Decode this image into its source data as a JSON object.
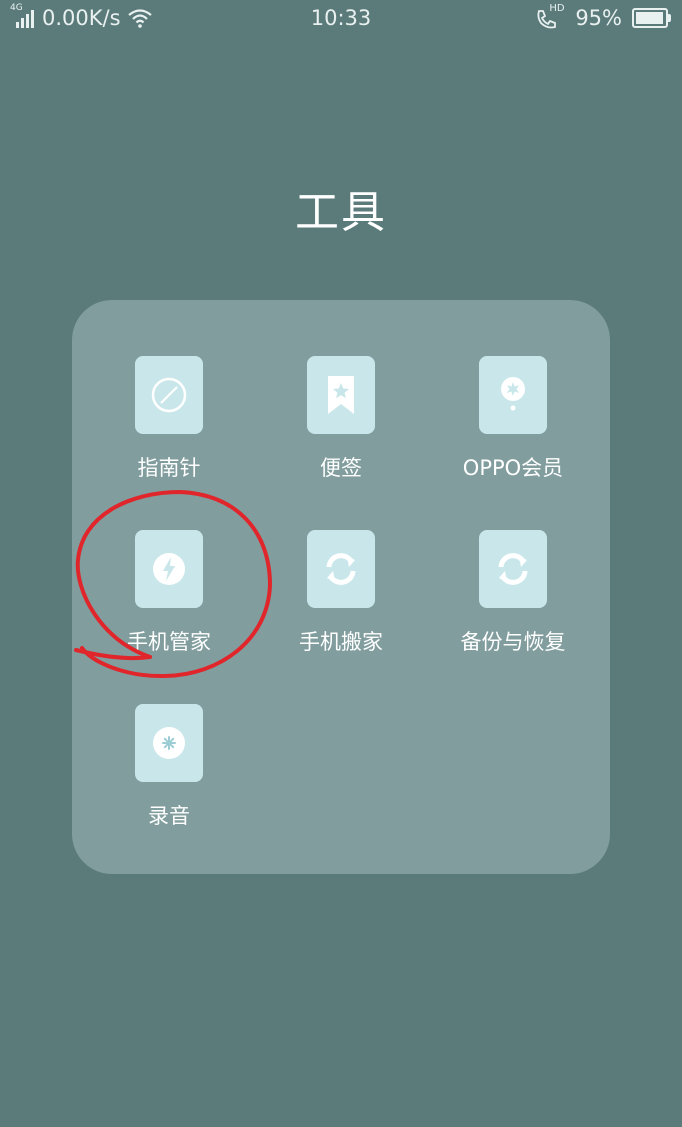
{
  "status_bar": {
    "network_type": "4G",
    "speed": "0.00K/s",
    "time": "10:33",
    "call_badge": "HD",
    "battery": "95%",
    "battery_level": 0.95
  },
  "folder": {
    "title": "工具",
    "apps": [
      {
        "label": "指南针",
        "icon": "compass-icon"
      },
      {
        "label": "便签",
        "icon": "bookmark-star-icon"
      },
      {
        "label": "OPPO会员",
        "icon": "member-badge-icon"
      },
      {
        "label": "手机管家",
        "icon": "phone-manager-icon"
      },
      {
        "label": "手机搬家",
        "icon": "sync-arrows-icon"
      },
      {
        "label": "备份与恢复",
        "icon": "sync-arrows-icon"
      },
      {
        "label": "录音",
        "icon": "recorder-icon"
      }
    ]
  },
  "colors": {
    "background": "#5b7b7b",
    "folder_panel": "#8ca5a7",
    "app_tile": "#c9e7ea",
    "annotation": "#e0262b"
  }
}
